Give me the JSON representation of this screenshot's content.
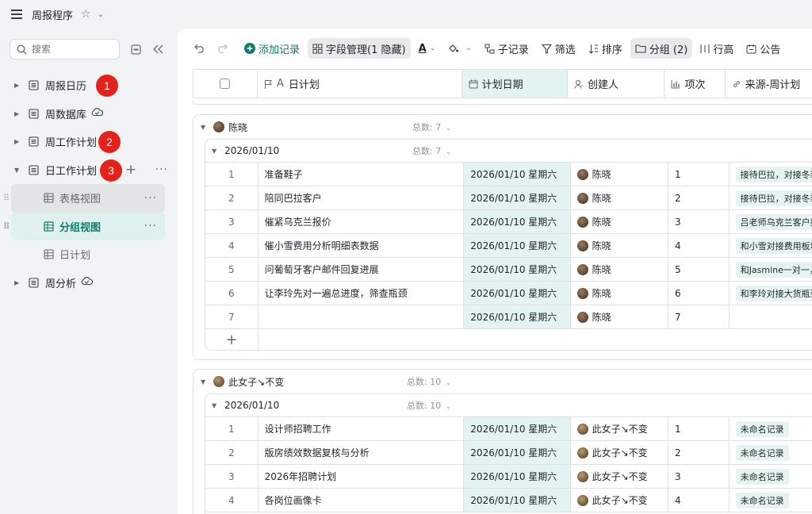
{
  "app": {
    "title": "周报程序"
  },
  "sidebar": {
    "search_placeholder": "搜索",
    "items": [
      {
        "label": "周报日历"
      },
      {
        "label": "周数据库"
      },
      {
        "label": "周工作计划"
      },
      {
        "label": "日工作计划"
      },
      {
        "label": "表格视图"
      },
      {
        "label": "分组视图"
      },
      {
        "label": "日计划"
      },
      {
        "label": "周分析"
      }
    ],
    "badges": [
      "1",
      "2",
      "3"
    ]
  },
  "toolbar": {
    "add_record": "添加记录",
    "field_manage": "字段管理(1 隐藏)",
    "text_color": "A",
    "sub_record": "子记录",
    "filter": "筛选",
    "sort": "排序",
    "group": "分组 (2)",
    "row_height": "行高",
    "announce": "公告"
  },
  "columns": [
    "日计划",
    "计划日期",
    "创建人",
    "项次",
    "来源-周计划"
  ],
  "groups": [
    {
      "name": "陈晓",
      "count": "总数: 7",
      "subgroups": [
        {
          "name": "2026/01/10",
          "count": "总数: 7",
          "rows": [
            {
              "idx": "1",
              "plan": "准备鞋子",
              "date": "2026/01/10 星期六",
              "creator": "陈晓",
              "item": "1",
              "source": "接待巴拉，对接冬装"
            },
            {
              "idx": "2",
              "plan": "陪同巴拉客户",
              "date": "2026/01/10 星期六",
              "creator": "陈晓",
              "item": "2",
              "source": "接待巴拉，对接冬装"
            },
            {
              "idx": "3",
              "plan": "催紧乌克兰报价",
              "date": "2026/01/10 星期六",
              "creator": "陈晓",
              "item": "3",
              "source": "吕老师乌克兰客户报"
            },
            {
              "idx": "4",
              "plan": "催小雪费用分析明细表数据",
              "date": "2026/01/10 星期六",
              "creator": "陈晓",
              "item": "4",
              "source": "和小雪对接费用板块"
            },
            {
              "idx": "5",
              "plan": "问葡萄牙客户邮件回复进展",
              "date": "2026/01/10 星期六",
              "creator": "陈晓",
              "item": "5",
              "source": "和Jasmine一对一，"
            },
            {
              "idx": "6",
              "plan": "让李玲先对一遍总进度，筛查瓶颈",
              "date": "2026/01/10 星期六",
              "creator": "陈晓",
              "item": "6",
              "source": "和李玲对接大货瓶颈"
            },
            {
              "idx": "7",
              "plan": "",
              "date": "2026/01/10 星期六",
              "creator": "陈晓",
              "item": "7",
              "source": ""
            }
          ],
          "add_label": "+"
        }
      ]
    },
    {
      "name": "此女子↘不变",
      "count": "总数: 10",
      "subgroups": [
        {
          "name": "2026/01/10",
          "count": "总数: 10",
          "rows": [
            {
              "idx": "1",
              "plan": "设计师招聘工作",
              "date": "2026/01/10 星期六",
              "creator": "此女子↘不变",
              "item": "1",
              "source": "未命名记录"
            },
            {
              "idx": "2",
              "plan": "版房绩效数据复核与分析",
              "date": "2026/01/10 星期六",
              "creator": "此女子↘不变",
              "item": "2",
              "source": "未命名记录"
            },
            {
              "idx": "3",
              "plan": "2026年招聘计划",
              "date": "2026/01/10 星期六",
              "creator": "此女子↘不变",
              "item": "3",
              "source": "未命名记录"
            },
            {
              "idx": "4",
              "plan": "各岗位画像卡",
              "date": "2026/01/10 星期六",
              "creator": "此女子↘不变",
              "item": "4",
              "source": "未命名记录"
            }
          ]
        }
      ]
    }
  ]
}
